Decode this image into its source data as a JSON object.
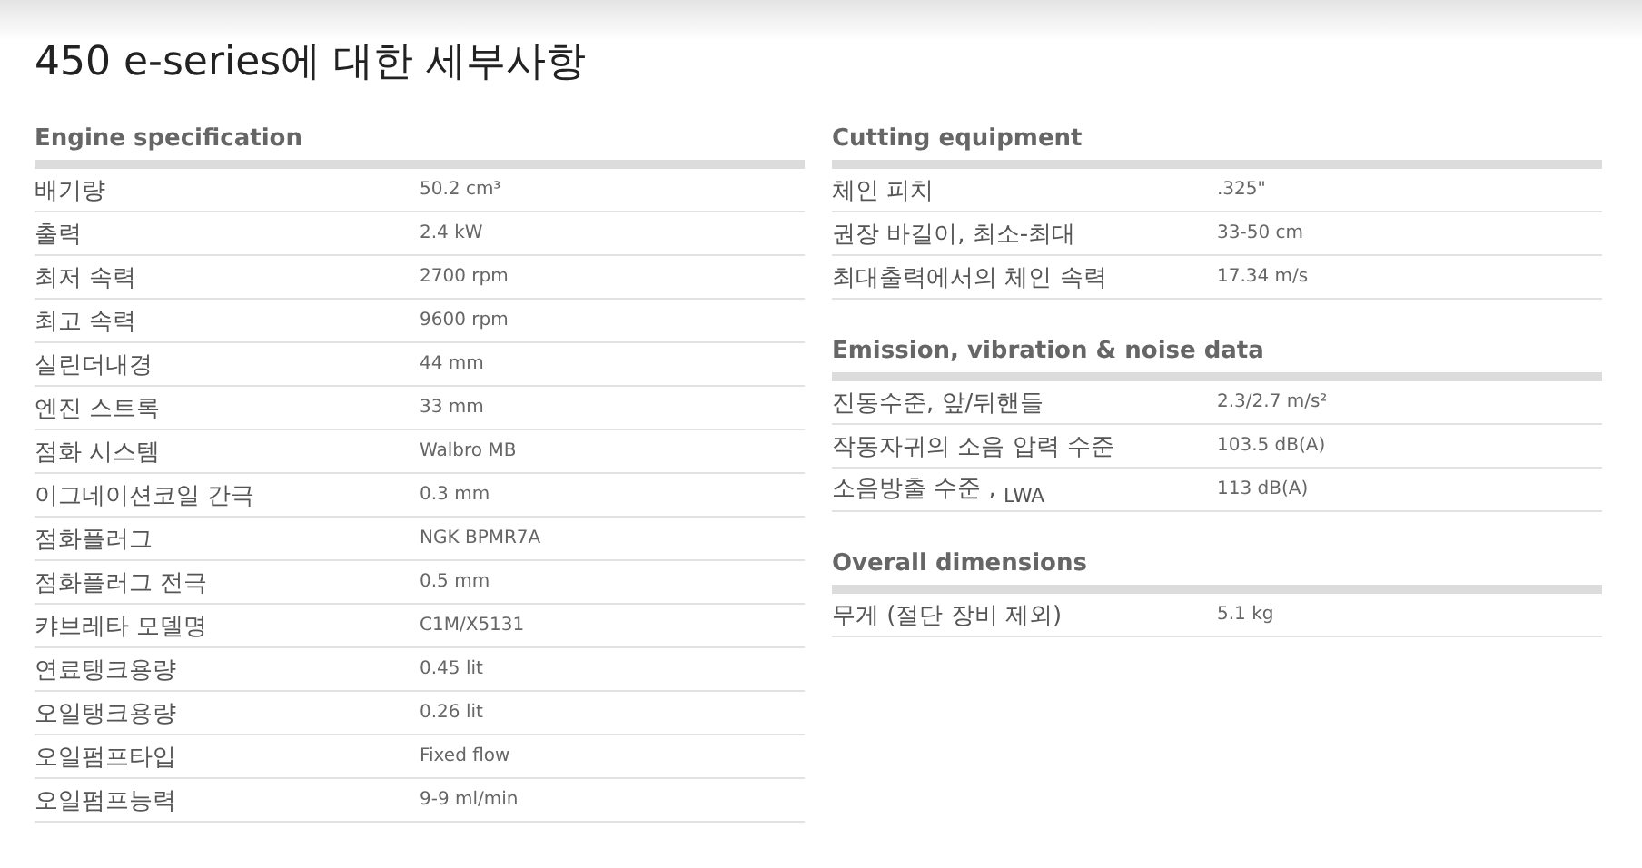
{
  "title": "450 e-series에 대한 세부사항",
  "columns": [
    [
      {
        "heading": "Engine specification",
        "rows": [
          {
            "label": "배기량",
            "value": "50.2 cm³"
          },
          {
            "label": "출력",
            "value": "2.4 kW"
          },
          {
            "label": "최저 속력",
            "value": "2700 rpm"
          },
          {
            "label": "최고 속력",
            "value": "9600 rpm"
          },
          {
            "label": "실린더내경",
            "value": "44 mm"
          },
          {
            "label": "엔진 스트록",
            "value": "33 mm"
          },
          {
            "label": "점화 시스템",
            "value": "Walbro MB"
          },
          {
            "label": "이그네이션코일 간극",
            "value": "0.3 mm"
          },
          {
            "label": "점화플러그",
            "value": "NGK BPMR7A"
          },
          {
            "label": "점화플러그 전극",
            "value": "0.5 mm"
          },
          {
            "label": "캬브레타 모델명",
            "value": "C1M/X5131"
          },
          {
            "label": "연료탱크용량",
            "value": "0.45 lit"
          },
          {
            "label": "오일탱크용량",
            "value": "0.26 lit"
          },
          {
            "label": "오일펌프타입",
            "value": "Fixed flow"
          },
          {
            "label": "오일펌프능력",
            "value": "9-9 ml/min"
          }
        ]
      }
    ],
    [
      {
        "heading": "Cutting equipment",
        "rows": [
          {
            "label": "체인 피치",
            "value": ".325\""
          },
          {
            "label": "권장 바길이, 최소-최대",
            "value": "33-50 cm"
          },
          {
            "label": "최대출력에서의 체인 속력",
            "value": "17.34 m/s"
          }
        ]
      },
      {
        "heading": "Emission, vibration & noise data",
        "rows": [
          {
            "label": "진동수준, 앞/뒤핸들",
            "value": "2.3/2.7 m/s²"
          },
          {
            "label": "작동자귀의 소음 압력 수준",
            "value": "103.5 dB(A)"
          },
          {
            "label": "소음방출 수준 , $_{LWA}$",
            "value": "113 dB(A)"
          }
        ]
      },
      {
        "heading": "Overall dimensions",
        "rows": [
          {
            "label": "무게 (절단 장비 제외)",
            "value": "5.1 kg"
          }
        ]
      }
    ]
  ]
}
